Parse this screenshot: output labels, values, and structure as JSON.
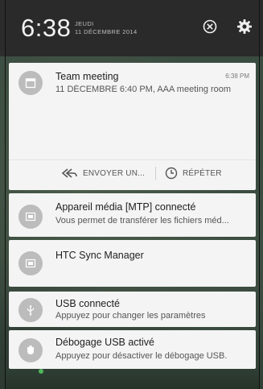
{
  "header": {
    "time": "6:38",
    "day": "JEUDI",
    "date": "11 DÉCEMBRE 2014",
    "clear_icon": "clear-all-icon",
    "settings_icon": "gear-icon"
  },
  "notifications": [
    {
      "title": "Team meeting",
      "text": "11 DÉCEMBRE 6:40 PM, AAA meeting room",
      "time": "6:38 PM",
      "icon": "calendar-icon",
      "actions": [
        {
          "label": "ENVOYER UN...",
          "icon": "reply-all-icon"
        },
        {
          "label": "RÉPÉTER",
          "icon": "clock-icon"
        }
      ]
    },
    {
      "title": "Appareil média [MTP] connecté",
      "text": "Vous permet de transférer les fichiers méd...",
      "icon": "media-device-icon"
    },
    {
      "title": "HTC Sync Manager",
      "icon": "sync-manager-icon"
    },
    {
      "title": "USB connecté",
      "text": "Appuyez pour changer les paramètres",
      "icon": "usb-icon"
    },
    {
      "title": "Débogage USB activé",
      "text": "Appuyez pour désactiver le débogage USB.",
      "icon": "debug-bug-icon"
    }
  ]
}
